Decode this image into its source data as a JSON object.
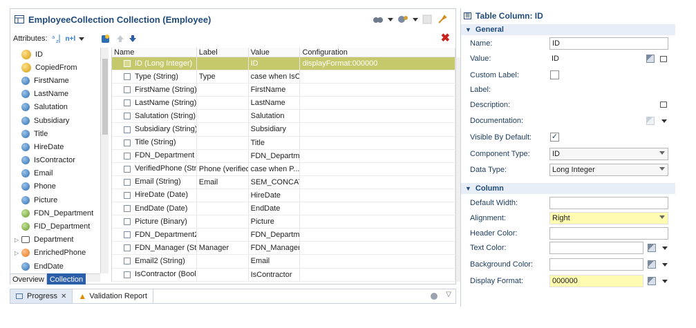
{
  "editor": {
    "title": "EmployeeCollection Collection (Employee)",
    "attributes_label": "Attributes:",
    "attributes_toggle": "n+l"
  },
  "tree": {
    "items": [
      "ID",
      "CopiedFrom",
      "FirstName",
      "LastName",
      "Salutation",
      "Subsidiary",
      "Title",
      "HireDate",
      "IsContractor",
      "Email",
      "Phone",
      "Picture",
      "FDN_Department",
      "FID_Department",
      "Department",
      "EnrichedPhone",
      "EndDate"
    ]
  },
  "grid": {
    "headers": [
      "Name",
      "Label",
      "Value",
      "Configuration"
    ],
    "rows": [
      {
        "name": "ID (Long Integer)",
        "label": "",
        "value": "ID",
        "config": "displayFormat:000000"
      },
      {
        "name": "Type (String)",
        "label": "Type",
        "value": "case when IsC...",
        "config": ""
      },
      {
        "name": "FirstName (String)",
        "label": "",
        "value": "FirstName",
        "config": ""
      },
      {
        "name": "LastName (String)",
        "label": "",
        "value": "LastName",
        "config": ""
      },
      {
        "name": "Salutation (String)",
        "label": "",
        "value": "Salutation",
        "config": ""
      },
      {
        "name": "Subsidiary (String)",
        "label": "",
        "value": "Subsidiary",
        "config": ""
      },
      {
        "name": "Title (String)",
        "label": "",
        "value": "Title",
        "config": ""
      },
      {
        "name": "FDN_Department (...",
        "label": "",
        "value": "FDN_Departm...",
        "config": ""
      },
      {
        "name": "VerifiedPhone (Stri...",
        "label": "Phone (verified)",
        "value": "case  when P...",
        "config": ""
      },
      {
        "name": "Email (String)",
        "label": "Email",
        "value": "SEM_CONCAT...",
        "config": ""
      },
      {
        "name": "HireDate (Date)",
        "label": "",
        "value": "HireDate",
        "config": ""
      },
      {
        "name": "EndDate (Date)",
        "label": "",
        "value": "EndDate",
        "config": ""
      },
      {
        "name": "Picture (Binary)",
        "label": "",
        "value": "Picture",
        "config": ""
      },
      {
        "name": "FDN_Department2 ...",
        "label": "",
        "value": "FDN_Departm...",
        "config": ""
      },
      {
        "name": "FDN_Manager (Stri...",
        "label": "Manager",
        "value": "FDN_Manager",
        "config": ""
      },
      {
        "name": "Email2 (String)",
        "label": "",
        "value": "Email",
        "config": ""
      },
      {
        "name": "IsContractor (Boole...",
        "label": "",
        "value": "IsContractor",
        "config": ""
      }
    ]
  },
  "bottom_tabs": [
    "Overview",
    "Collection"
  ],
  "progress": {
    "tab_progress": "Progress",
    "tab_validation": "Validation Report"
  },
  "props": {
    "title": "Table Column: ID",
    "section_general": "General",
    "section_column": "Column",
    "name_label": "Name:",
    "name_value": "ID",
    "value_label": "Value:",
    "value_value": "ID",
    "custom_label_label": "Custom Label:",
    "label_label": "Label:",
    "description_label": "Description:",
    "documentation_label": "Documentation:",
    "visible_label": "Visible By Default:",
    "visible_check": "✓",
    "component_label": "Component Type:",
    "component_value": "ID",
    "datatype_label": "Data Type:",
    "datatype_value": "Long Integer",
    "default_width_label": "Default Width:",
    "alignment_label": "Alignment:",
    "alignment_value": "Right",
    "header_color_label": "Header Color:",
    "text_color_label": "Text Color:",
    "bg_color_label": "Background Color:",
    "display_format_label": "Display Format:",
    "display_format_value": "000000"
  }
}
